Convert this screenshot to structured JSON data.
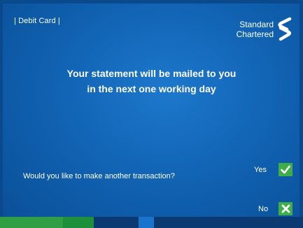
{
  "header": {
    "section_label": "| Debit Card |",
    "brand_line1": "Standard",
    "brand_line2": "Chartered"
  },
  "message": {
    "line1": "Your statement will be mailed to you",
    "line2": "in the next one working day"
  },
  "prompt": {
    "question": "Would you like to make another transaction?",
    "yes_label": "Yes",
    "no_label": "No"
  },
  "icons": {
    "brand_mark": "standard-chartered-logo-icon",
    "yes": "check-icon",
    "no": "x-icon"
  },
  "colors": {
    "background": "#0f5fae",
    "option_green": "#3fae49",
    "stripe": [
      "#2f9e44",
      "#1e8f3a",
      "#0b3a72",
      "#1a74cc",
      "#0b3a72"
    ]
  }
}
